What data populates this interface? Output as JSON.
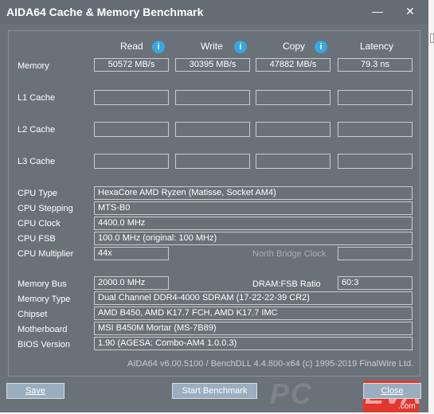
{
  "window": {
    "title": "AIDA64 Cache & Memory Benchmark",
    "minimize_glyph": "—",
    "close_glyph": "✕"
  },
  "columns": {
    "read": "Read",
    "write": "Write",
    "copy": "Copy",
    "latency": "Latency",
    "info_glyph": "i"
  },
  "rows": {
    "memory": {
      "label": "Memory",
      "read": "50572 MB/s",
      "write": "30395 MB/s",
      "copy": "47882 MB/s",
      "latency": "79.3 ns"
    },
    "l1": {
      "label": "L1 Cache"
    },
    "l2": {
      "label": "L2 Cache"
    },
    "l3": {
      "label": "L3 Cache"
    }
  },
  "cpu": {
    "type_label": "CPU Type",
    "type": "HexaCore AMD Ryzen  (Matisse, Socket AM4)",
    "stepping_label": "CPU Stepping",
    "stepping": "MTS-B0",
    "clock_label": "CPU Clock",
    "clock": "4400.0 MHz",
    "fsb_label": "CPU FSB",
    "fsb": "100.0 MHz  (original: 100 MHz)",
    "multiplier_label": "CPU Multiplier",
    "multiplier": "44x",
    "nb_clock_label": "North Bridge Clock"
  },
  "system": {
    "bus_label": "Memory Bus",
    "bus": "2000.0 MHz",
    "ratio_label": "DRAM:FSB Ratio",
    "ratio": "60:3",
    "memtype_label": "Memory Type",
    "memtype": "Dual Channel DDR4-4000 SDRAM  (17-22-22-39 CR2)",
    "chipset_label": "Chipset",
    "chipset": "AMD B450, AMD K17.7 FCH, AMD K17.7 IMC",
    "motherboard_label": "Motherboard",
    "motherboard": "MSI B450M Mortar (MS-7B89)",
    "bios_label": "BIOS Version",
    "bios": "1.90  (AGESA: Combo-AM4 1.0.0.3)"
  },
  "footer": "AIDA64 v6.00.5100 / BenchDLL 4.4.800-x64  (c) 1995-2019 FinalWire Ltd.",
  "buttons": {
    "save": "Save",
    "start": "Start Benchmark",
    "close": "Close"
  },
  "watermark": {
    "text1": "PC",
    "text2": "EVA",
    "domain": ".com"
  }
}
